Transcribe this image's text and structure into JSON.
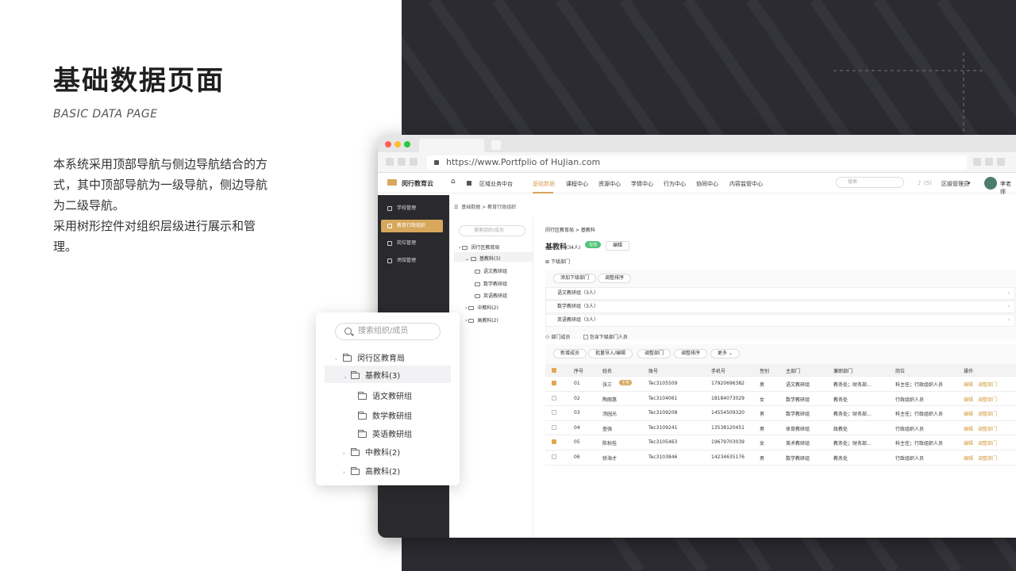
{
  "hero": {
    "title": "基础数据页面",
    "subtitle": "BASIC DATA PAGE",
    "desc_line1": "本系统采用顶部导航与侧边导航结合的方式，其中顶部导航为一级导航，侧边导航为二级导航。",
    "desc_line2": "采用树形控件对组织层级进行展示和管理。"
  },
  "browser": {
    "url": "https://www.Portfplio of HuJian.com"
  },
  "app": {
    "logo": "闵行教育云",
    "region": "区域业务中台",
    "nav": [
      "基础数据",
      "课程中心",
      "资源中心",
      "学情中心",
      "行为中心",
      "协同中心",
      "内容监管中心"
    ],
    "search_placeholder": "搜索",
    "notice_count": "(5)",
    "role": "区级管理员",
    "user": "李老师"
  },
  "sidebar": [
    "学校管理",
    "教育行政组织",
    "岗位管理",
    "场馆管理"
  ],
  "breadcrumb": [
    "基础数据",
    "教育行政组织"
  ],
  "tree_small": {
    "search_placeholder": "搜索组织/成员",
    "nodes": [
      "闵行区教育局",
      "基教科(3)",
      "语文教研组",
      "数学教研组",
      "英语教研组",
      "中教科(2)",
      "高教科(2)"
    ]
  },
  "main": {
    "path": [
      "闵行区教育局",
      "基教科"
    ],
    "dept_name": "基教科",
    "dept_count": "(34人)",
    "status": "在线",
    "edit": "编辑",
    "sub_title": "下级部门",
    "btn_add_sub": "添加下级部门",
    "btn_sort": "调整排序",
    "subdepts": [
      "语文教研组（3人）",
      "数学教研组（3人）",
      "英语教研组（3人）"
    ],
    "members_title": "部门成员",
    "include_sub": "包含下级部门人员",
    "btn_new": "新增成员",
    "btn_batch": "批量导入/编辑",
    "btn_move": "调整部门",
    "btn_sort2": "调整排序",
    "btn_more": "更多",
    "headers": [
      "序号",
      "姓名",
      "账号",
      "手机号",
      "性别",
      "主部门",
      "兼职部门",
      "岗位",
      "操作"
    ],
    "rows": [
      {
        "no": "01",
        "name": "张三",
        "tag": "主管",
        "acct": "Tec3105509",
        "phone": "17920696382",
        "sex": "男",
        "dept": "语文教研组",
        "part": "教务处；财务部...",
        "post": "科主任；行政组织人员",
        "checked": true
      },
      {
        "no": "02",
        "name": "陶丽惠",
        "tag": "",
        "acct": "Tec3104061",
        "phone": "18184073029",
        "sex": "女",
        "dept": "数学教研组",
        "part": "教务处",
        "post": "行政组织人员",
        "checked": false
      },
      {
        "no": "03",
        "name": "汤园光",
        "tag": "",
        "acct": "Tec3109208",
        "phone": "14554509320",
        "sex": "男",
        "dept": "数学教研组",
        "part": "教务处；财务部...",
        "post": "科主任；行政组织人员",
        "checked": false
      },
      {
        "no": "04",
        "name": "查强",
        "tag": "",
        "acct": "Tec3109241",
        "phone": "13538120451",
        "sex": "男",
        "dept": "体育教研组",
        "part": "政教处",
        "post": "行政组织人员",
        "checked": false
      },
      {
        "no": "05",
        "name": "陈秋桂",
        "tag": "",
        "acct": "Tec3105463",
        "phone": "19679703039",
        "sex": "女",
        "dept": "美术教研组",
        "part": "教务处；财务部...",
        "post": "科主任；行政组织人员",
        "checked": true
      },
      {
        "no": "06",
        "name": "骄海才",
        "tag": "",
        "acct": "Tec3103846",
        "phone": "14234635176",
        "sex": "男",
        "dept": "数学教研组",
        "part": "教务处",
        "post": "行政组织人员",
        "checked": false
      }
    ],
    "op_edit": "编辑",
    "op_adjust": "调整部门"
  },
  "popup": {
    "search_placeholder": "搜索组织/成员",
    "nodes": [
      "闵行区教育局",
      "基教科(3)",
      "语文教研组",
      "数学教研组",
      "英语教研组",
      "中教科(2)",
      "高教科(2)"
    ]
  },
  "colors": {
    "accent": "#d6a75c",
    "dark": "#2b2b31",
    "status": "#52c47a"
  }
}
